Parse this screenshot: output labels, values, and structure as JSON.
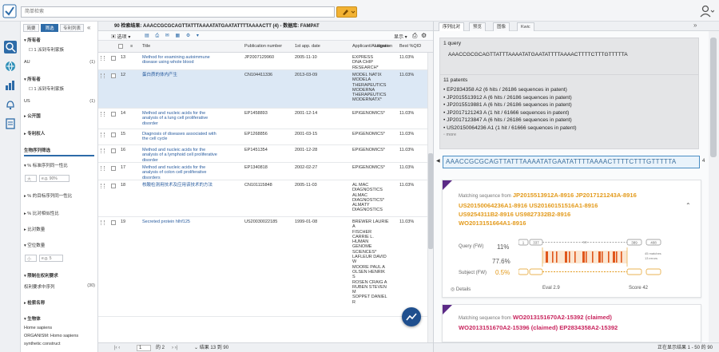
{
  "topbar": {
    "search_placeholder": "简单检索"
  },
  "filters": {
    "tabs": [
      "简要",
      "筛选",
      "专利列表"
    ],
    "sections": [
      {
        "title": "所有者",
        "items": [
          {
            "label": "1 派到专利家族",
            "count": ""
          },
          {
            "label": "AU",
            "count": "(1)"
          }
        ]
      },
      {
        "title": "所有者",
        "items": [
          {
            "label": "1 派到专利家族",
            "count": ""
          },
          {
            "label": "US",
            "count": "(1)"
          }
        ]
      },
      {
        "title": "公开国",
        "items": []
      },
      {
        "title": "专利权人",
        "items": []
      }
    ],
    "bio_title": "生物序列筛选",
    "pct_id_label": "% 标准序列同一性比",
    "pct_id_op": "大",
    "pct_id_placeholder": "e.g. 90%",
    "pct_sim_label": "% 的目标序列同一性比",
    "pct_match_label": "% 比对相似性比",
    "align_count": "比对数量",
    "gap_count": "空位数量",
    "gap_op": "小",
    "gap_placeholder": "e.g. 5",
    "claim_title": "限制在权利要求",
    "claim_item": "权利要求中序列",
    "claim_count": "(30)",
    "db_title": "检索名称",
    "org_title": "生物体",
    "org_items": [
      "Home sapiens",
      "ORGANISM: Homo sapiens",
      "synthetic construct"
    ]
  },
  "results": {
    "header": "90 检索结果:  AAACCGCGCAGTTATTTAAAATATGAATATTTTAAAACTT (4) - 数据库: FAMPAT",
    "toolbar_select": "选项",
    "toolbar_display": "显示",
    "columns": [
      "Title",
      "Publication number",
      "1st app. date",
      "Applicant/Assignee",
      "Litigation",
      "Best %QID"
    ],
    "rows": [
      {
        "num": "13",
        "title": "Method for examining autoimmune\ndisease using whole blood",
        "pub": "JP2007129960",
        "date": "2005-11-10",
        "applicant": "EXPRESS\nDNA CHIP\nRESEARCH*",
        "best": "11.03%",
        "selected": false
      },
      {
        "num": "12",
        "title": "蛋白质的体内产生",
        "pub": "CN104411336",
        "date": "2013-03-09",
        "applicant": "MODEL NATIX\nMODELA\nTHERAPEUTICS\nMODERNA\nTHERAPEUTICS\nMODERNATX*",
        "best": "11.03%",
        "selected": true
      },
      {
        "num": "14",
        "title": "Method and nucleic acids for the\nanalysis of a lung cell proliferative\ndisorder",
        "pub": "EP1458893",
        "date": "2001-12-14",
        "applicant": "EPIGENOMICS*",
        "best": "11.03%",
        "selected": false
      },
      {
        "num": "15",
        "title": "Diagnosis of diseases associated with\nthe cell cycle",
        "pub": "EP1268856",
        "date": "2001-03-15",
        "applicant": "EPIGENOMICS*",
        "best": "11.03%",
        "selected": false
      },
      {
        "num": "16",
        "title": "Method and nucleic acids for the\nanalysis of a lymphoid cell proliferative\ndisorder",
        "pub": "EP1451354",
        "date": "2001-12-28",
        "applicant": "EPIGENOMICS*",
        "best": "11.03%",
        "selected": false
      },
      {
        "num": "17",
        "title": "Method and nucleic acids for the\nanalysis of colon cell proliferative\ndisorders",
        "pub": "EP1340818",
        "date": "2002-02-27",
        "applicant": "EPIGENOMICS*",
        "best": "11.03%",
        "selected": false
      },
      {
        "num": "18",
        "title": "核酸检测用技术及应用该技术的方法",
        "pub": "CN101115848",
        "date": "2005-11-03",
        "applicant": "AL MAC\nDIAGNOSTICS\nALMAC\nDIAGNOSTICS*\nALMATY\nDIAGNOSTICS",
        "best": "11.03%",
        "selected": false
      },
      {
        "num": "19",
        "title": "Secreted protein hlhf125",
        "pub": "US20030022185",
        "date": "1999-01-08",
        "applicant": "BREWER LAURIE\nA\nFISCHER\nCARRIE L.\nHUMAN\nGENOME\nSCIENCES*\nLAFLEUR DAVID\nW\nMOORE PAUL A\nOLSEN HENRIK\nS\nROSEN CRAIG A\nRUBEN STEVEN\nM\nSOPPET DANIEL\nR",
        "best": "11.03%",
        "selected": false
      }
    ],
    "pager_page": "1",
    "pager_total": "的 2",
    "pager_range": "结果 13 到 90"
  },
  "right": {
    "tabs": [
      "序列比对",
      "预览",
      "图像",
      "Kwic"
    ],
    "query_title": "1 query",
    "query_seq": "AAACCGCGCAGTTATTTAAAATATGAATATTTTAAAACTTTTCTTTGTTTTTA",
    "patents_title": "11 patents",
    "patents": [
      "EP2834358 A2 (6 hits / 26186 sequences in patent)",
      "JP2015513912 A (6 hits / 26186 sequences in patent)",
      "JP2015519881 A (6 hits / 26186 sequences in patent)",
      "JP2017121243 A (1 hit / 61666 sequences in patent)",
      "JP2017123847 A (6 hits / 26186 sequences in patent)",
      "US20150064236 A1 (1 hit / 61666 sequences in patent)"
    ],
    "more": "more",
    "seq_bar": "AAACCGCGCAGTTATTTAAAATATGAATATTTTAAAACTTTTCTTTGTTTTTA",
    "seq_bar_end": "4",
    "card1": {
      "prefix": "Matching sequence from",
      "ids": "JP2015513912A-8916  JP2017121243A-8916\nUS20150064236A1-8916  US20160151516A1-8916\nUS9254311B2-8916  US9827332B2-8916\nWO2013151664A1-8916",
      "query_label": "Query (FW)",
      "query_pct": "11%",
      "mid_pct": "77.6%",
      "subject_label": "Subject (FW)",
      "subject_pct": "0.5%",
      "details": "Details",
      "eval": "Eval 2.9",
      "score": "Score 42",
      "n1": "1",
      "n2": "337",
      "n3": "389",
      "n4": "408",
      "gap": "53",
      "matches": "45 matches",
      "errors": "13 errors",
      "color": "#f0a020"
    },
    "card2": {
      "prefix": "Matching sequence from",
      "line1": "WO2013151670A2-15392 (claimed)",
      "line2": "WO2013151670A2-15396 (claimed)  EP2834358A2-15392",
      "color": "#c8245d"
    },
    "status": "正在显示结果 1 - 50 的 90",
    "accent": "#5b2a86"
  }
}
